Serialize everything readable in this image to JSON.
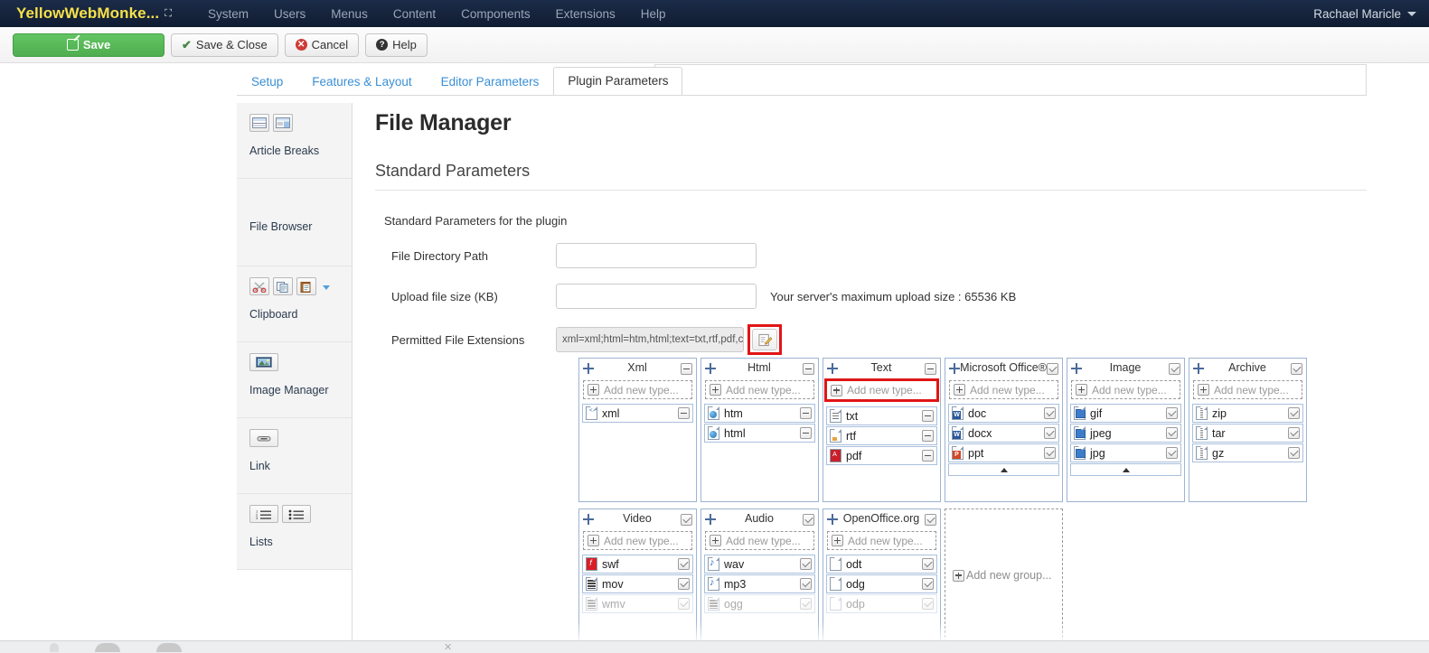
{
  "topbar": {
    "brand": "YellowWebMonke...",
    "brand_icon": "external-link-icon",
    "menu": [
      "System",
      "Users",
      "Menus",
      "Content",
      "Components",
      "Extensions",
      "Help"
    ],
    "user": "Rachael Maricle"
  },
  "toolbar": {
    "save": "Save",
    "save_close": "Save & Close",
    "cancel": "Cancel",
    "help": "Help"
  },
  "tabs": [
    {
      "label": "Setup",
      "active": false
    },
    {
      "label": "Features & Layout",
      "active": false
    },
    {
      "label": "Editor Parameters",
      "active": false
    },
    {
      "label": "Plugin Parameters",
      "active": true
    }
  ],
  "sidebar": [
    {
      "label": "Article Breaks",
      "icons": [
        "page-break-icon",
        "pagebreak-layout-icon"
      ]
    },
    {
      "label": "File Browser",
      "icons": []
    },
    {
      "label": "Clipboard",
      "icons": [
        "cut-scissors-icon",
        "copy-icon",
        "paste-icon",
        "paste-dropdown-icon"
      ]
    },
    {
      "label": "Image Manager",
      "icons": [
        "image-icon"
      ]
    },
    {
      "label": "Link",
      "icons": [
        "link-icon"
      ]
    },
    {
      "label": "Lists",
      "icons": [
        "ordered-list-icon",
        "unordered-list-icon"
      ]
    }
  ],
  "main": {
    "page_title": "File Manager",
    "section_title": "Standard Parameters",
    "legend": "Standard Parameters for the plugin",
    "fields": [
      {
        "label": "File Directory Path",
        "value": "",
        "type": "text"
      },
      {
        "label": "Upload file size (KB)",
        "value": "",
        "type": "text",
        "note": "Your server's maximum upload size : 65536 KB"
      },
      {
        "label": "Permitted File Extensions",
        "value": "xml=xml;html=htm,html;text=txt,rtf,pdf,c",
        "type": "readonly"
      }
    ],
    "edit_button_icon": "edit-pencil-icon",
    "add_new_group": "Add new group...",
    "add_new_type": "Add new type..."
  },
  "groups": {
    "row1": [
      {
        "title": "Xml",
        "header_control": "minus",
        "highlight_add": false,
        "scroll_up": false,
        "types": [
          {
            "name": "xml",
            "icon": "xmlic",
            "control": "minus",
            "faded": false
          }
        ]
      },
      {
        "title": "Html",
        "header_control": "minus",
        "highlight_add": false,
        "scroll_up": false,
        "types": [
          {
            "name": "htm",
            "icon": "blue",
            "control": "minus",
            "faded": false
          },
          {
            "name": "html",
            "icon": "blue",
            "control": "minus",
            "faded": false
          }
        ]
      },
      {
        "title": "Text",
        "header_control": "minus",
        "highlight_add": true,
        "scroll_up": false,
        "types": [
          {
            "name": "txt",
            "icon": "lines",
            "control": "minus",
            "faded": false
          },
          {
            "name": "rtf",
            "icon": "rtf",
            "control": "minus",
            "faded": false
          },
          {
            "name": "pdf",
            "icon": "pdf",
            "control": "minus",
            "faded": false
          }
        ]
      },
      {
        "title": "Microsoft Office®",
        "header_control": "checked",
        "highlight_add": false,
        "scroll_up": true,
        "types": [
          {
            "name": "doc",
            "icon": "word",
            "control": "checked",
            "faded": false
          },
          {
            "name": "docx",
            "icon": "word",
            "control": "checked",
            "faded": false
          },
          {
            "name": "ppt",
            "icon": "ppt",
            "control": "checked",
            "faded": false
          }
        ]
      },
      {
        "title": "Image",
        "header_control": "checked",
        "highlight_add": false,
        "scroll_up": true,
        "types": [
          {
            "name": "gif",
            "icon": "img",
            "control": "checked",
            "faded": false
          },
          {
            "name": "jpeg",
            "icon": "img",
            "control": "checked",
            "faded": false
          },
          {
            "name": "jpg",
            "icon": "img",
            "control": "checked",
            "faded": false
          }
        ]
      },
      {
        "title": "Archive",
        "header_control": "checked",
        "highlight_add": false,
        "scroll_up": false,
        "types": [
          {
            "name": "zip",
            "icon": "zip",
            "control": "checked",
            "faded": false
          },
          {
            "name": "tar",
            "icon": "zip",
            "control": "checked",
            "faded": false
          },
          {
            "name": "gz",
            "icon": "zip",
            "control": "checked",
            "faded": false
          }
        ]
      }
    ],
    "row2": [
      {
        "title": "Video",
        "header_control": "checked",
        "highlight_add": false,
        "scroll_up": false,
        "types": [
          {
            "name": "swf",
            "icon": "swf",
            "control": "checked",
            "faded": false
          },
          {
            "name": "mov",
            "icon": "film",
            "control": "checked",
            "faded": false
          },
          {
            "name": "wmv",
            "icon": "film",
            "control": "checked",
            "faded": true
          }
        ]
      },
      {
        "title": "Audio",
        "header_control": "checked",
        "highlight_add": false,
        "scroll_up": false,
        "types": [
          {
            "name": "wav",
            "icon": "note",
            "control": "checked",
            "faded": false
          },
          {
            "name": "mp3",
            "icon": "note",
            "control": "checked",
            "faded": false
          },
          {
            "name": "ogg",
            "icon": "film",
            "control": "checked",
            "faded": true
          }
        ]
      },
      {
        "title": "OpenOffice.org",
        "header_control": "checked",
        "highlight_add": false,
        "scroll_up": false,
        "types": [
          {
            "name": "odt",
            "icon": "plain",
            "control": "checked",
            "faded": false
          },
          {
            "name": "odg",
            "icon": "plain",
            "control": "checked",
            "faded": false
          },
          {
            "name": "odp",
            "icon": "plain",
            "control": "checked",
            "faded": true
          }
        ]
      }
    ]
  },
  "colors": {
    "topbar": "#16243c",
    "brand": "#f6e04a",
    "save_green": "#4fae4f",
    "tab_link": "#3a8fd4",
    "highlight_red": "#e11515",
    "group_border": "#9cb4d4"
  }
}
